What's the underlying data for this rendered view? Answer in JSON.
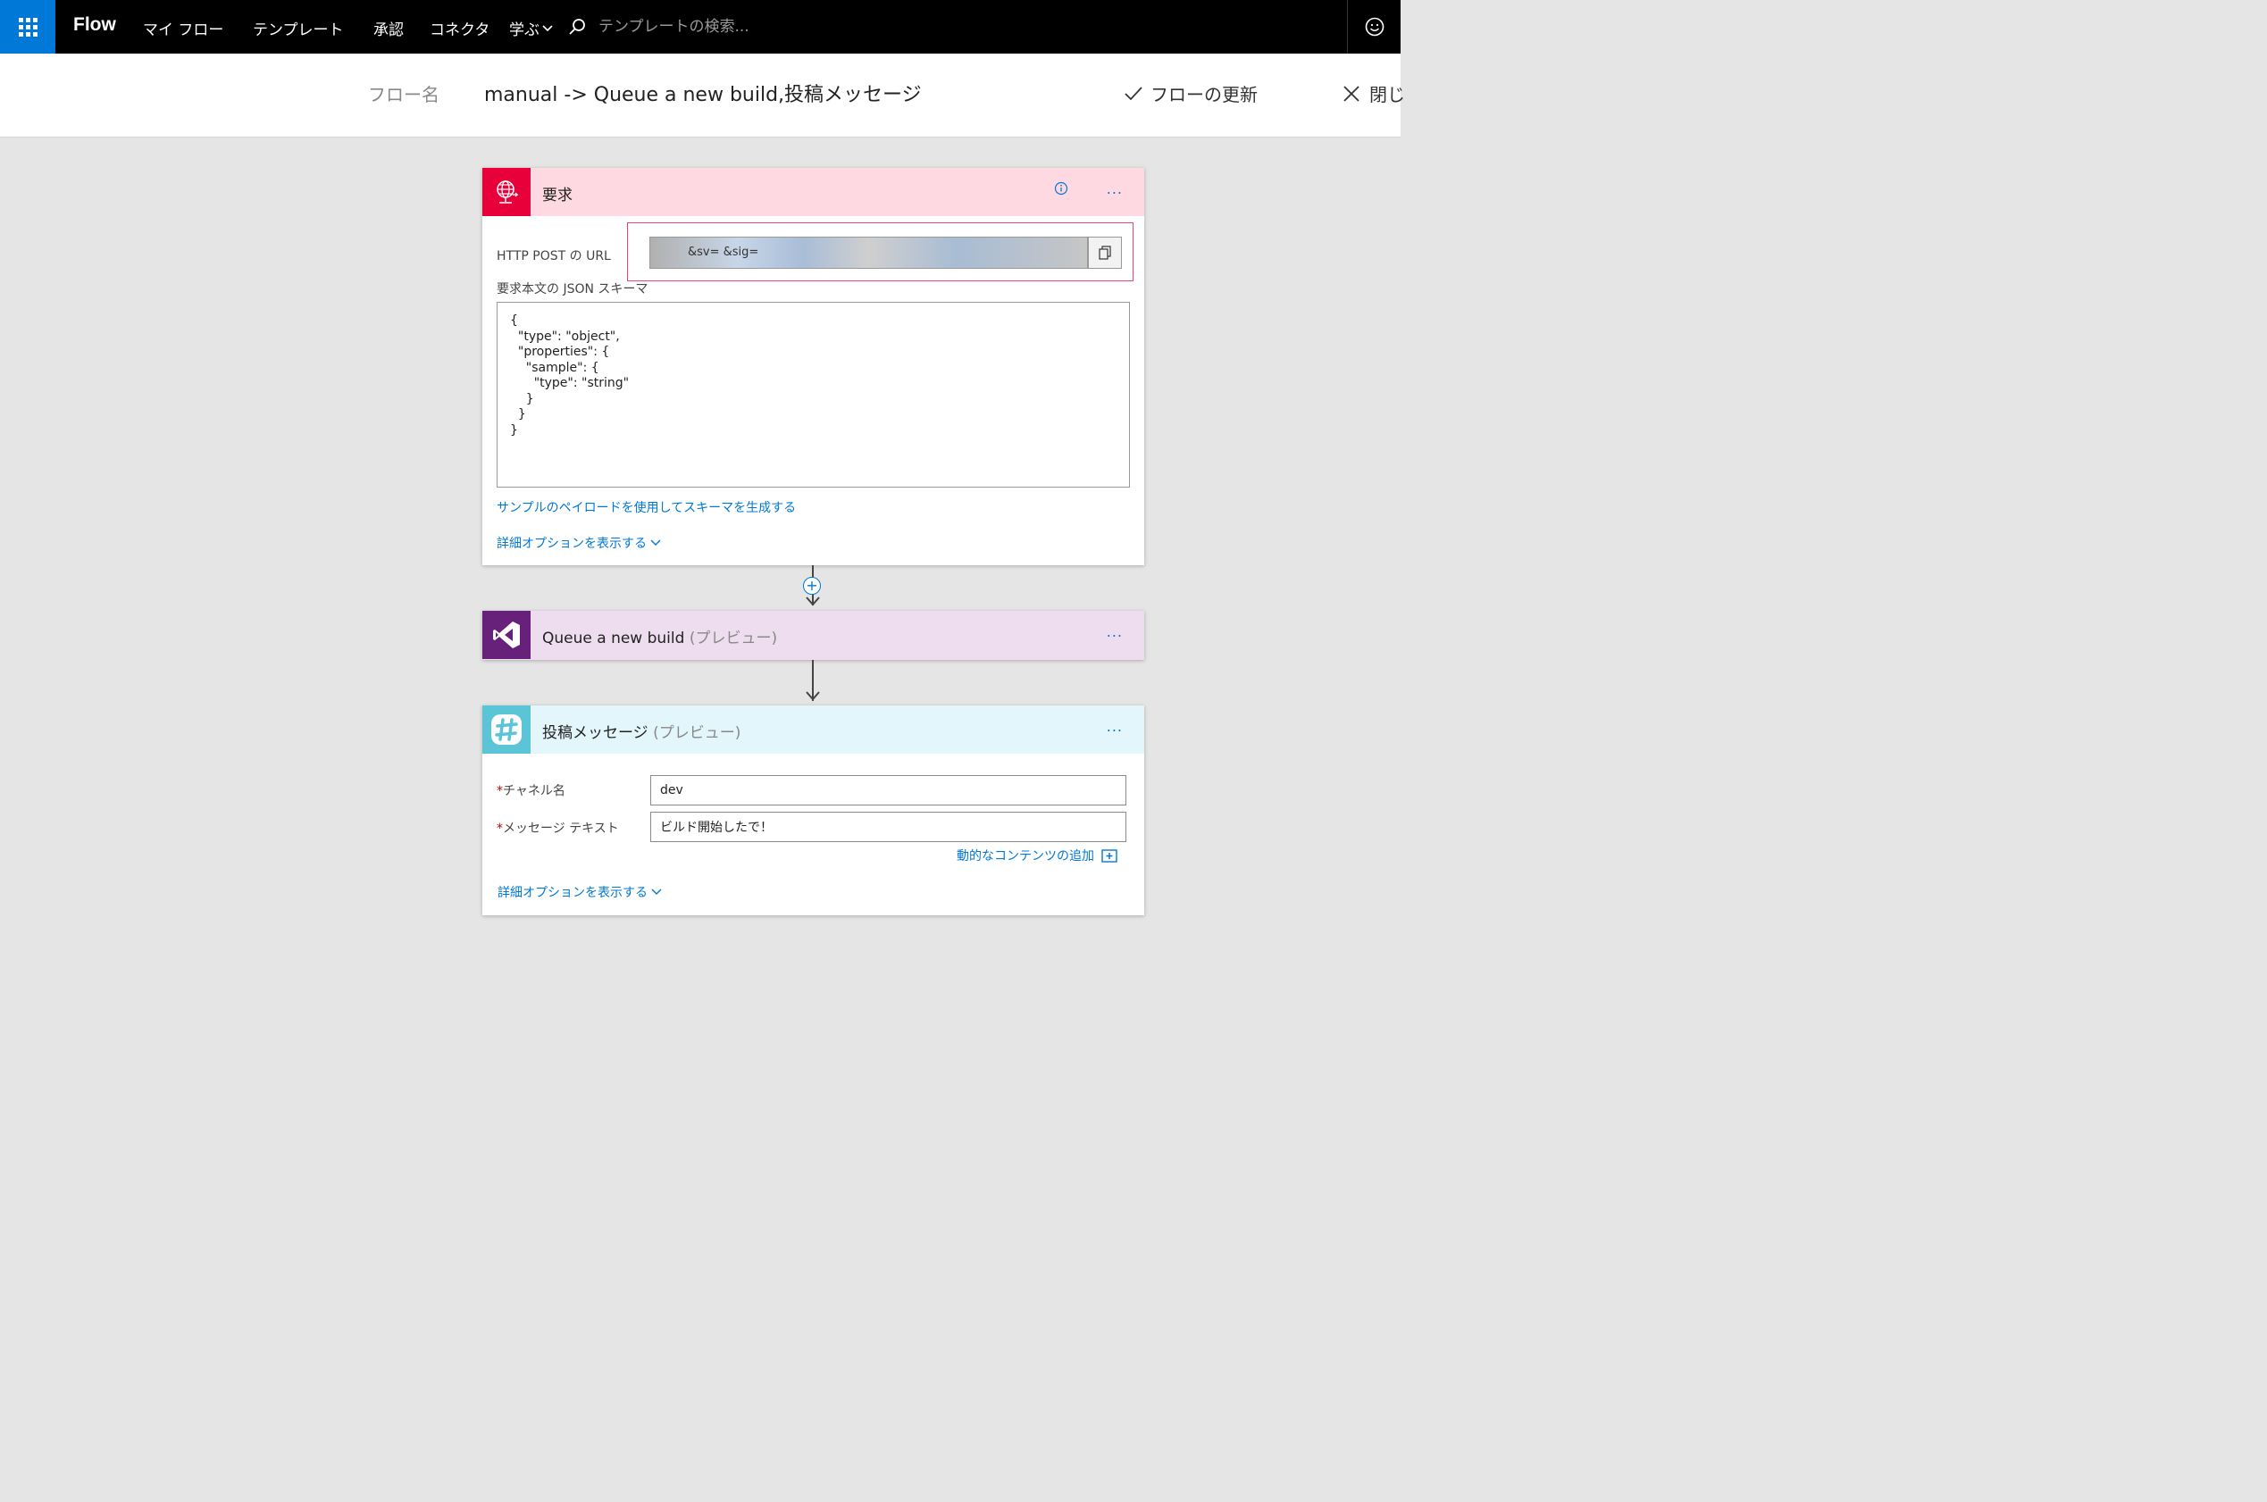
{
  "nav": {
    "brand": "Flow",
    "items": [
      "マイ フロー",
      "テンプレート",
      "承認",
      "コネクタ",
      "学ぶ"
    ],
    "search_placeholder": "テンプレートの検索..."
  },
  "header": {
    "flow_name_label": "フロー名",
    "flow_name": "manual -> Queue a new build,投稿メッセージ",
    "update_label": "フローの更新",
    "close_label": "閉じ"
  },
  "card_request": {
    "title": "要求",
    "more": "...",
    "url_label": "HTTP POST の URL",
    "url_value": "&sv=      &sig=",
    "schema_label": "要求本文の JSON スキーマ",
    "schema_text": "{\n  \"type\": \"object\",\n  \"properties\": {\n    \"sample\": {\n      \"type\": \"string\"\n    }\n  }\n}",
    "generate_link": "サンプルのペイロードを使用してスキーマを生成する",
    "advanced_link": "詳細オプションを表示する"
  },
  "card_build": {
    "title": "Queue a new build",
    "preview": "(プレビュー)",
    "more": "..."
  },
  "card_slack": {
    "title": "投稿メッセージ",
    "preview": "(プレビュー)",
    "more": "...",
    "channel_label": "チャネル名",
    "channel_value": "dev",
    "message_label": "メッセージ テキスト",
    "message_value": "ビルド開始したで！",
    "required_mark": "*",
    "dynamic_link": "動的なコンテンツの追加",
    "advanced_link": "詳細オプションを表示する"
  },
  "colors": {
    "accent": "#0078d7",
    "request_brand": "#e8003b",
    "vsts_brand": "#68217a",
    "slack_brand": "#5bc4d7"
  }
}
